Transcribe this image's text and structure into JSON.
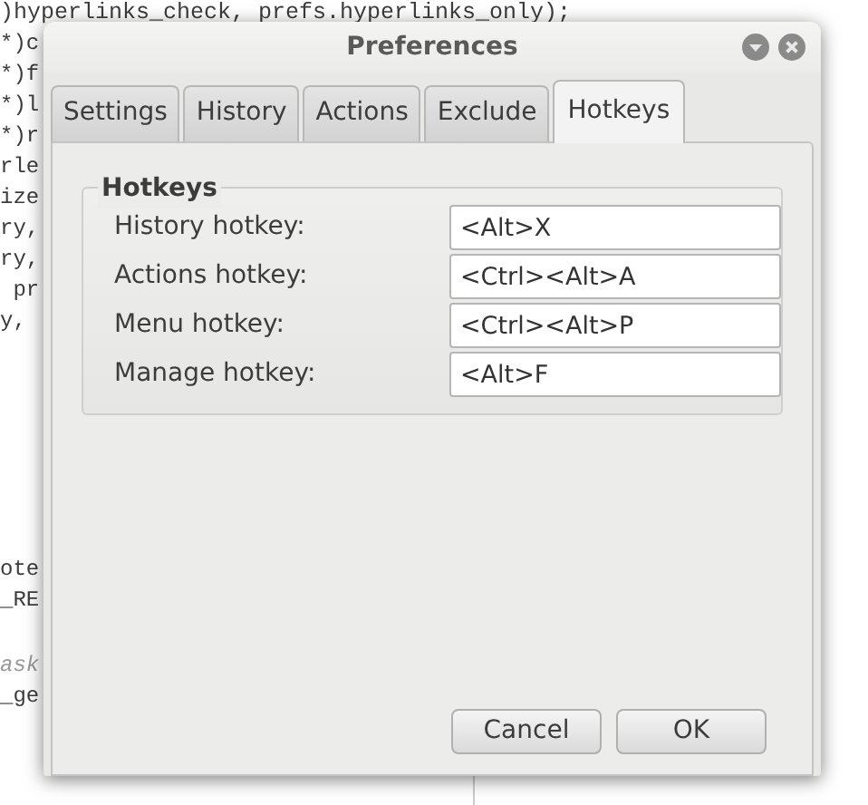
{
  "background_code": {
    "top": [
      {
        "text": ")hyperlinks_check, prefs.hyperlinks_only);",
        "kind": "code"
      },
      {
        "text": "*)c",
        "kind": "code"
      },
      {
        "text": "*)f",
        "kind": "code"
      },
      {
        "text": "*)l",
        "kind": "code"
      },
      {
        "text": "*)r",
        "kind": "code"
      },
      {
        "text": "rle",
        "kind": "code"
      },
      {
        "text": "ize",
        "kind": "code"
      },
      {
        "text": "ry,",
        "kind": "code"
      },
      {
        "text": "ry,",
        "kind": "code"
      },
      {
        "text": " pr",
        "kind": "code"
      },
      {
        "text": "y,",
        "kind": "code"
      }
    ],
    "bottom": [
      {
        "text": "ote",
        "kind": "code"
      },
      {
        "text": "_RE",
        "kind": "code"
      },
      {
        "text": "ask",
        "kind": "comment"
      },
      {
        "text": "_ge",
        "kind": "code"
      }
    ]
  },
  "window": {
    "title": "Preferences"
  },
  "tabs": [
    {
      "label": "Settings",
      "selected": false
    },
    {
      "label": "History",
      "selected": false
    },
    {
      "label": "Actions",
      "selected": false
    },
    {
      "label": "Exclude",
      "selected": false
    },
    {
      "label": "Hotkeys",
      "selected": true
    }
  ],
  "frame": {
    "title": "Hotkeys",
    "rows": [
      {
        "label": "History hotkey:",
        "value": "<Alt>X"
      },
      {
        "label": "Actions hotkey:",
        "value": "<Ctrl><Alt>A"
      },
      {
        "label": "Menu hotkey:",
        "value": "<Ctrl><Alt>P"
      },
      {
        "label": "Manage hotkey:",
        "value": "<Alt>F"
      }
    ]
  },
  "buttons": [
    "Cancel",
    "OK"
  ]
}
